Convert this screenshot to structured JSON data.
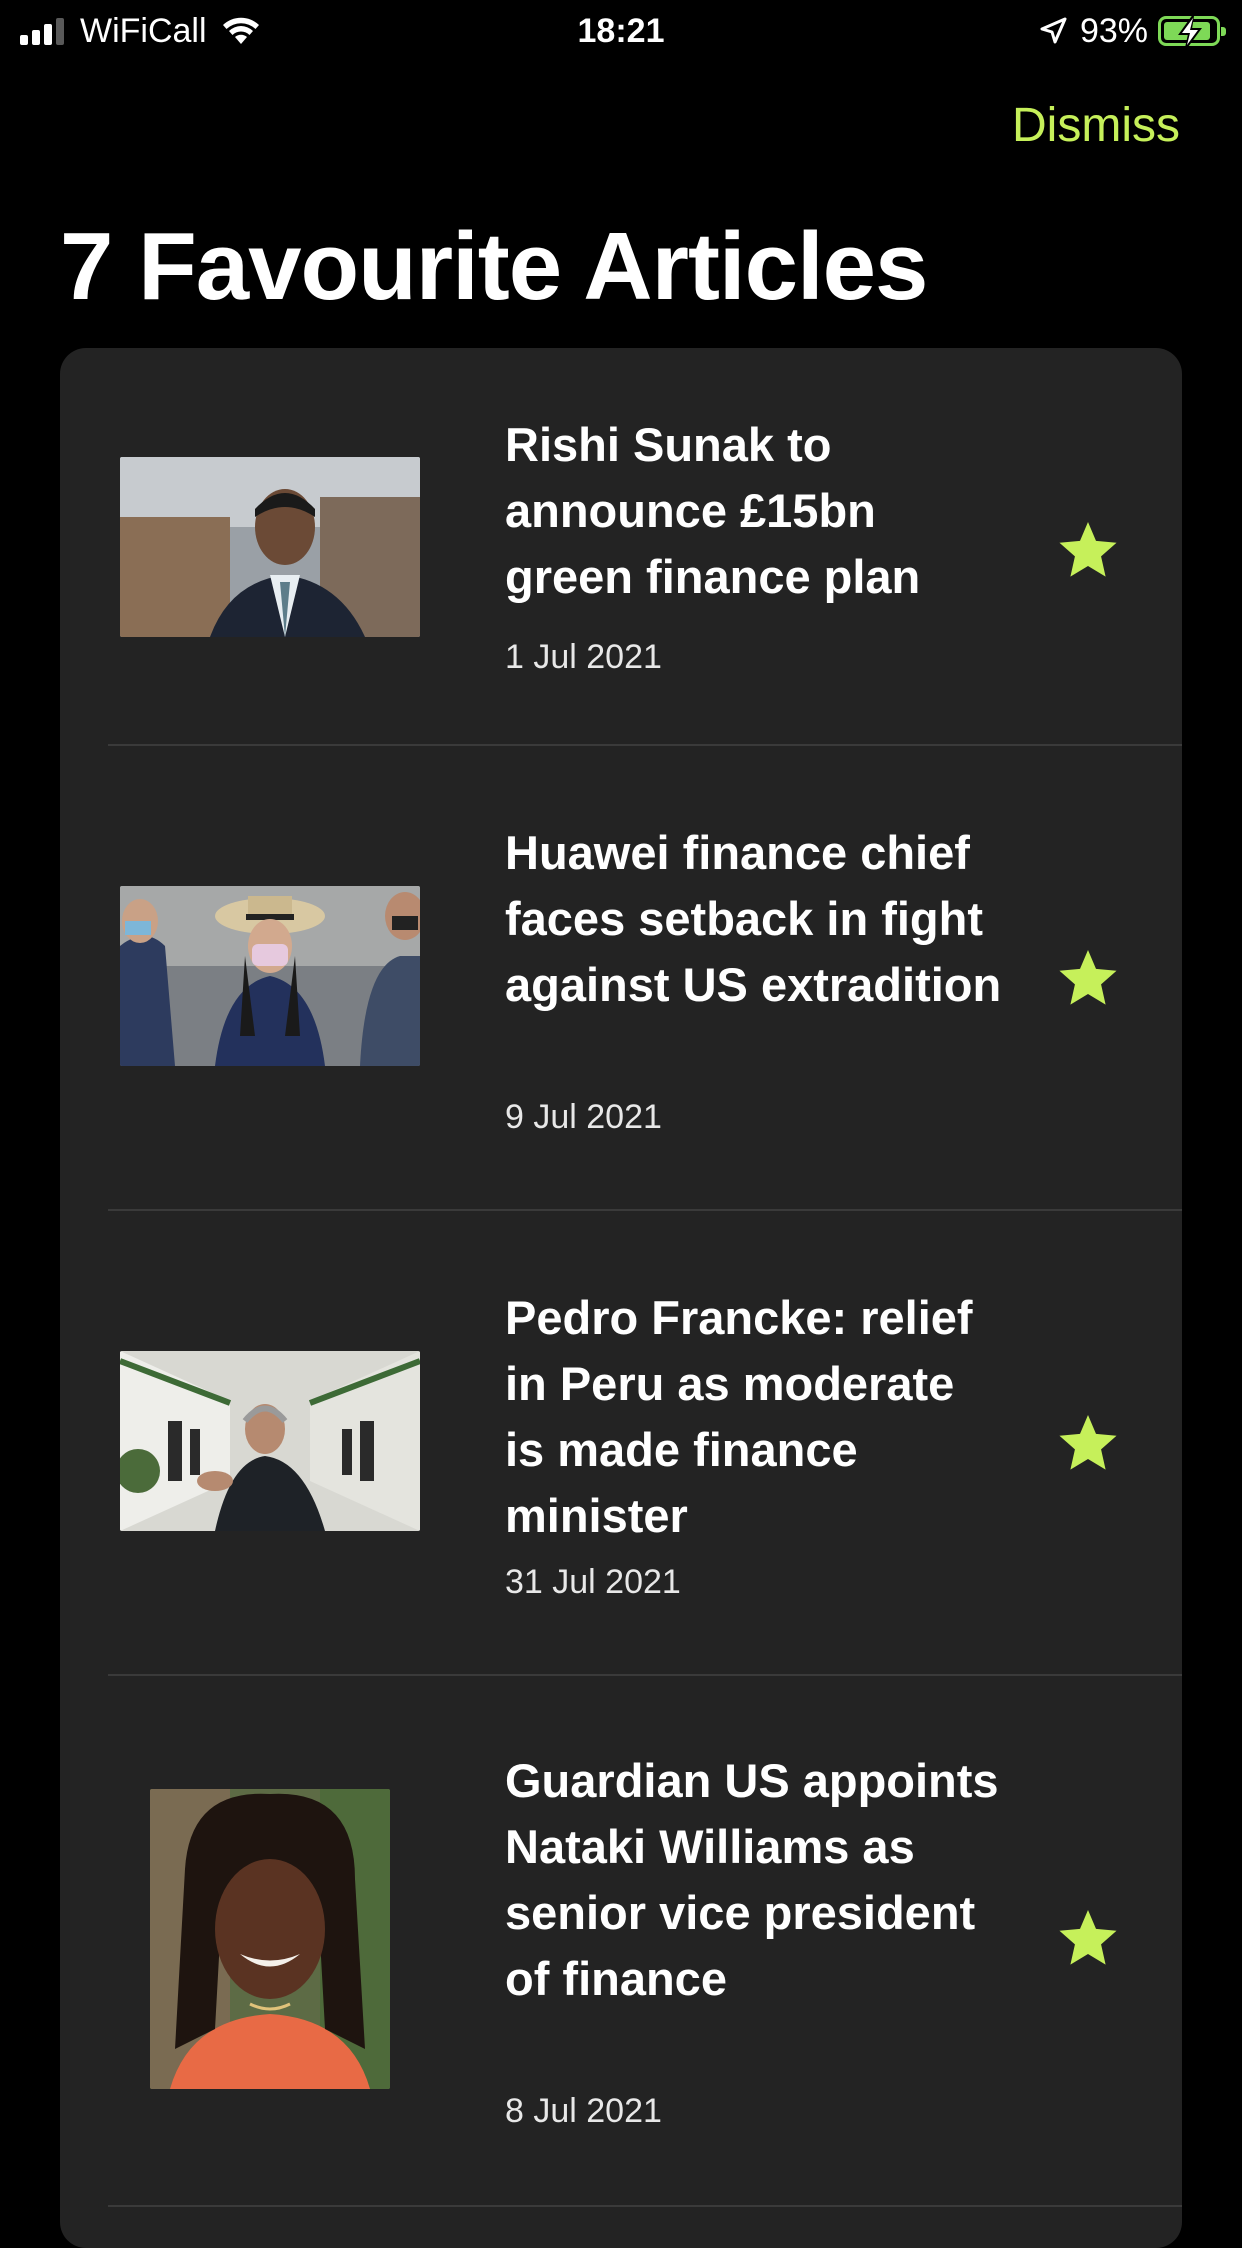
{
  "status_bar": {
    "carrier": "WiFiCall",
    "time": "18:21",
    "battery": "93%",
    "battery_level": 0.93
  },
  "header": {
    "dismiss_label": "Dismiss",
    "title": "7 Favourite Articles"
  },
  "accent_color": "#c6f05a",
  "articles": [
    {
      "title": "Rishi Sunak to announce £15bn green finance plan",
      "date": "1 Jul 2021",
      "favourite": true
    },
    {
      "title": "Huawei finance chief faces setback in fight against US extradition",
      "date": "9 Jul 2021",
      "favourite": true
    },
    {
      "title": "Pedro Francke: relief in Peru as moderate is made finance minister",
      "date": "31 Jul 2021",
      "favourite": true
    },
    {
      "title": "Guardian US appoints Nataki Williams as senior vice president of finance",
      "date": "8 Jul 2021",
      "favourite": true
    }
  ]
}
